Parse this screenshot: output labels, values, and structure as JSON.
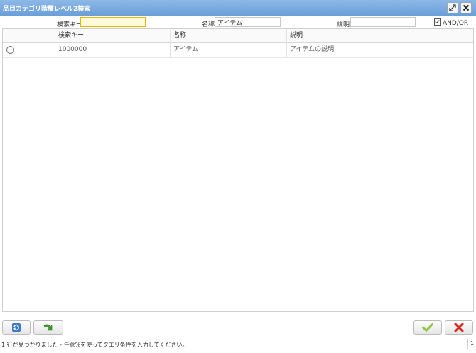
{
  "window": {
    "title": "品目カテゴリ階層レベル2検索"
  },
  "titlebar_buttons": {
    "maximize_icon": "maximize-icon",
    "close_icon": "close-icon"
  },
  "search": {
    "key_label": "検索キー",
    "key_value": "",
    "name_label": "名称",
    "name_value": "アイテム",
    "desc_label": "説明",
    "desc_value": "",
    "andor_label": "AND/OR",
    "andor_checked": true
  },
  "table": {
    "columns": [
      "",
      "検索キー",
      "名称",
      "説明"
    ],
    "rows": [
      {
        "key": "1000000",
        "name": "アイテム",
        "desc": "アイテムの説明"
      }
    ]
  },
  "footer": {
    "refresh_icon": "refresh-icon",
    "reset_icon": "reset-arrow-icon",
    "ok_icon": "checkmark-icon",
    "cancel_icon": "cancel-x-icon",
    "status": "1 行が見つかりました - 任意%を使ってクエリ条件を入力してください。",
    "page": "1"
  },
  "colors": {
    "titlebar": "#7aaade",
    "ok_green": "#8cc63f",
    "cancel_red": "#d9261c",
    "focus_bg": "#fffbd8"
  }
}
